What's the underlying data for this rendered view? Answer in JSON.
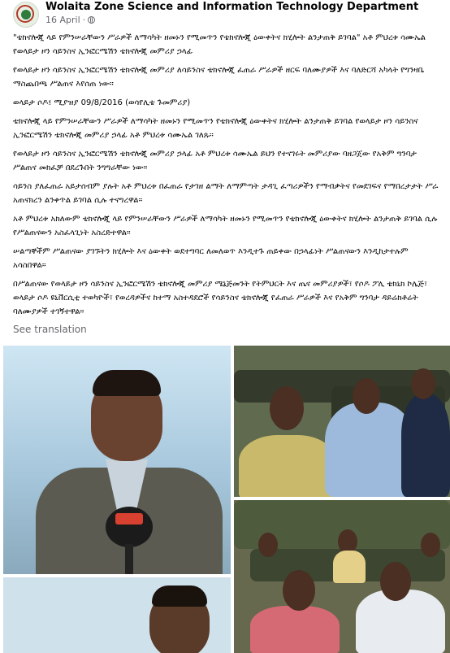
{
  "header": {
    "page_name": "Wolaita Zone Science and Information Technology Department",
    "date": "16 April",
    "separator": "·",
    "privacy_icon": "globe-icon",
    "avatar_icon": "page-logo"
  },
  "post": {
    "paragraphs": [
      "\"ቴክኖሎጂ ላይ የምንሠራቸውን ሥራዎች ለማሳካት ዘመኑን የሚመጥን የቴክኖሎጂ ዕውቀትና ክሂሎት ልንታጠቅ ይገባል\" አቶ ምህረቱ ሳሙኤል የወላይታ ዞን ሳይንስና ኢንፎርሜሽን ቴክኖሎጂ መምሪያ ኃላፊ",
      "የወላይታ ዞን ሳይንስና ኢንፎርሜሽን ቴክኖሎጂ መምሪያ ለሳይንስና ቴክኖሎጂ ፈጠራ ሥራዎች ዘርፍ ባለሙያዎች እና ባለድርሻ አካላት የግንዛቤ ማስጨበጫ ሥልጠና እየሰጠ ነው።",
      "ወላይታ ሶዶ፤ ሚያዝያ 09/8/2016 (ወሳየሊቴ ጉመምሪያ)",
      "ቴክኖሎጂ ላይ የምንሠራቸውን ሥራዎች ለማሳካት ዘመኑን የሚመጥን የቴክኖሎጂ ዕውቀትና ክሂሎት ልንታጠቅ ይገባል የወላይታ ዞን ሳይንስና ኢንፎርሜሽን ቴክኖሎጂ መምሪያ ኃላፊ አቶ ምህረቱ ሳሙኤል ገለጹ።",
      "የወላይታ ዞን ሳይንስና ኢንፎርሜሽን ቴክኖሎጂ መምሪያ ኃላፊ አቶ ምህረቱ ሳሙኤል ይህን የተናገሩት መምሪያው ባዘጋጀው የአቅም ግንባታ ሥልጠና መክፈቻ በደረጉበት ንግግራቸው ነው።",
      "ሳይንስ ያለፈጠራ አይታሰብም ያሉት አቶ ምህረቱ በፈጠራ የታገዘ ልማት ለማምጣት ታዳጊ ፈጣሪዎችን የማብቃትና የመደገፍና የማበረታታት ሥራ አጠናክረን ልንቀጥል ይገባል ሲሉ ተናግረዋል።",
      "አቶ ምህረቱ አክለውም ቴክኖሎጂ ላይ የምንሠራቸውን ሥራዎች ለማሳካት ዘመኑን የሚመጥን የቴክኖሎጂ ዕውቀትና ክሂሎት ልንታጠቅ ይገባል ሲሉ የሥልጠናውን አስፈላጊነት አስረድተዋል።",
      "ሠልጣኞችም ሥልጠናው ያገኙትን ክሂሎት እና ዕውቀት ወደተግባር ለመለወጥ እንዲተጉ ጠይቀው በኃላፊነት ሥልጠናውን እንዲከታተሉም አሳስበዋል።",
      "በሥልጠናው የወላይታ ዞን ሳይንስና ኢንፎርሜሽን ቴክኖሎጂ መምሪያ ሜኔጅመንት የትምህርት እና ጤና መምሪያዎች፣ የሶዶ ፖሊ ቴክኒክ ኮሌጅ፣ ወላይታ ሶዶ ዩኒቨርሲቲ ተወካዮች፣ የወረዳዎችና ከተማ አስተዳደሮች የሳይንስና ቴክኖሎጂ የፈጠራ ሥራዎች እና የአቅም ግንባታ ዳይሬክቶሬት ባለሙያዎች ተገኝተዋል።"
    ],
    "see_translation": "See translation"
  },
  "photos": {
    "photo1_alt": "speaker-photo",
    "photo2_alt": "audience-photo-1",
    "photo3_alt": "audience-photo-2",
    "photo4_alt": "audience-photo-3"
  },
  "colors": {
    "accent_red": "#b23a2b",
    "meta_gray": "#65676b"
  }
}
